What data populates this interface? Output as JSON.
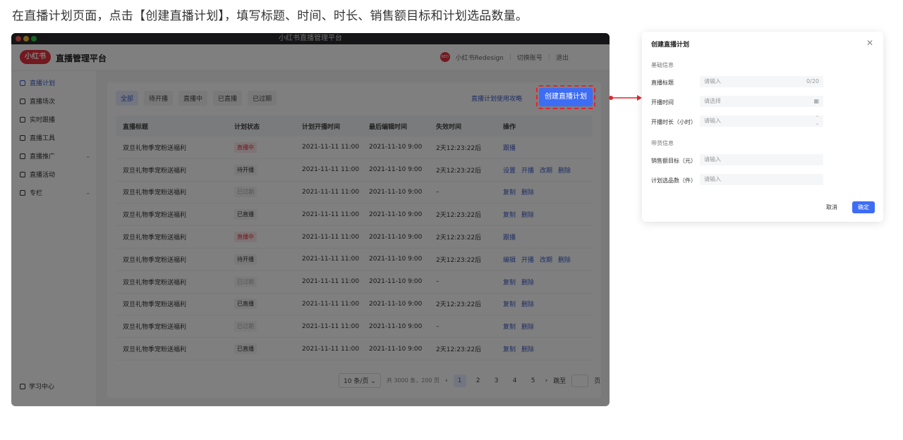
{
  "instruction": "在直播计划页面，点击【创建直播计划】，填写标题、时间、时长、销售额目标和计划选品数量。",
  "window": {
    "title": "小红书直播管理平台"
  },
  "header": {
    "logo_text": "小红书",
    "app_name": "直播管理平台",
    "user_name": "小红书Redesign",
    "switch_account": "切换账号",
    "logout": "退出"
  },
  "sidebar": {
    "items": [
      {
        "label": "直播计划",
        "icon": "calendar-icon"
      },
      {
        "label": "直播场次",
        "icon": "grid-icon"
      },
      {
        "label": "实时跟播",
        "icon": "monitor-icon"
      },
      {
        "label": "直播工具",
        "icon": "bulb-icon"
      },
      {
        "label": "直播推广",
        "icon": "trend-icon"
      },
      {
        "label": "直播活动",
        "icon": "flag-icon"
      },
      {
        "label": "专栏",
        "icon": "column-icon"
      }
    ],
    "help": "学习中心"
  },
  "filters": [
    "全部",
    "待开播",
    "直播中",
    "已直播",
    "已过期"
  ],
  "guide_link": "直播计划使用攻略",
  "create_button": "创建直播计划",
  "table": {
    "headers": [
      "直播标题",
      "计划状态",
      "计划开播时间",
      "最后编辑时间",
      "失效时间",
      "操作"
    ],
    "rows": [
      {
        "title": "双旦礼物季宠粉送福利",
        "status": "直播中",
        "start": "2021-11-11 11:00",
        "edited": "2021-11-10 9:00",
        "expire": "2天12:23:22后",
        "ops": [
          "跟播"
        ]
      },
      {
        "title": "双旦礼物季宠粉送福利",
        "status": "待开播",
        "start": "2021-11-11 11:00",
        "edited": "2021-11-10 9:00",
        "expire": "2天12:23:22后",
        "ops": [
          "设置",
          "开播",
          "改期",
          "删除"
        ]
      },
      {
        "title": "双旦礼物季宠粉送福利",
        "status": "已过期",
        "start": "2021-11-11 11:00",
        "edited": "2021-11-10 9:00",
        "expire": "–",
        "ops": [
          "复制",
          "删除"
        ]
      },
      {
        "title": "双旦礼物季宠粉送福利",
        "status": "已直播",
        "start": "2021-11-11 11:00",
        "edited": "2021-11-10 9:00",
        "expire": "2天12:23:22后",
        "ops": [
          "复制",
          "删除"
        ]
      },
      {
        "title": "双旦礼物季宠粉送福利",
        "status": "直播中",
        "start": "2021-11-11 11:00",
        "edited": "2021-11-10 9:00",
        "expire": "2天12:23:22后",
        "ops": [
          "跟播"
        ]
      },
      {
        "title": "双旦礼物季宠粉送福利",
        "status": "待开播",
        "start": "2021-11-11 11:00",
        "edited": "2021-11-10 9:00",
        "expire": "2天12:23:22后",
        "ops": [
          "编辑",
          "开播",
          "改期",
          "删除"
        ]
      },
      {
        "title": "双旦礼物季宠粉送福利",
        "status": "已过期",
        "start": "2021-11-11 11:00",
        "edited": "2021-11-10 9:00",
        "expire": "–",
        "ops": [
          "复制",
          "删除"
        ]
      },
      {
        "title": "双旦礼物季宠粉送福利",
        "status": "已直播",
        "start": "2021-11-11 11:00",
        "edited": "2021-11-10 9:00",
        "expire": "2天12:23:22后",
        "ops": [
          "复制",
          "删除"
        ]
      },
      {
        "title": "双旦礼物季宠粉送福利",
        "status": "已过期",
        "start": "2021-11-11 11:00",
        "edited": "2021-11-10 9:00",
        "expire": "–",
        "ops": [
          "复制",
          "删除"
        ]
      },
      {
        "title": "双旦礼物季宠粉送福利",
        "status": "已直播",
        "start": "2021-11-11 11:00",
        "edited": "2021-11-10 9:00",
        "expire": "2天12:23:22后",
        "ops": [
          "复制",
          "删除"
        ]
      }
    ]
  },
  "pagination": {
    "page_size": "10 条/页",
    "total": "共 3000 条，200 页",
    "pages": [
      "1",
      "2",
      "3",
      "4",
      "5"
    ],
    "jump_label": "跳至",
    "page_unit": "页"
  },
  "dialog": {
    "title": "创建直播计划",
    "section_basic": "基础信息",
    "title_label": "直播标题",
    "title_placeholder": "请输入",
    "title_counter": "0/20",
    "time_label": "开播时间",
    "time_placeholder": "请选择",
    "duration_label": "开播时长（小时）",
    "duration_placeholder": "请输入",
    "section_goods": "带货信息",
    "sales_label": "销售额目标（元）",
    "sales_placeholder": "请输入",
    "items_label": "计划选品数（件）",
    "items_placeholder": "请输入",
    "cancel": "取消",
    "confirm": "确定"
  },
  "colors": {
    "accent": "#3d6cf5",
    "brand": "#e8303e",
    "highlight": "#e1252e"
  }
}
